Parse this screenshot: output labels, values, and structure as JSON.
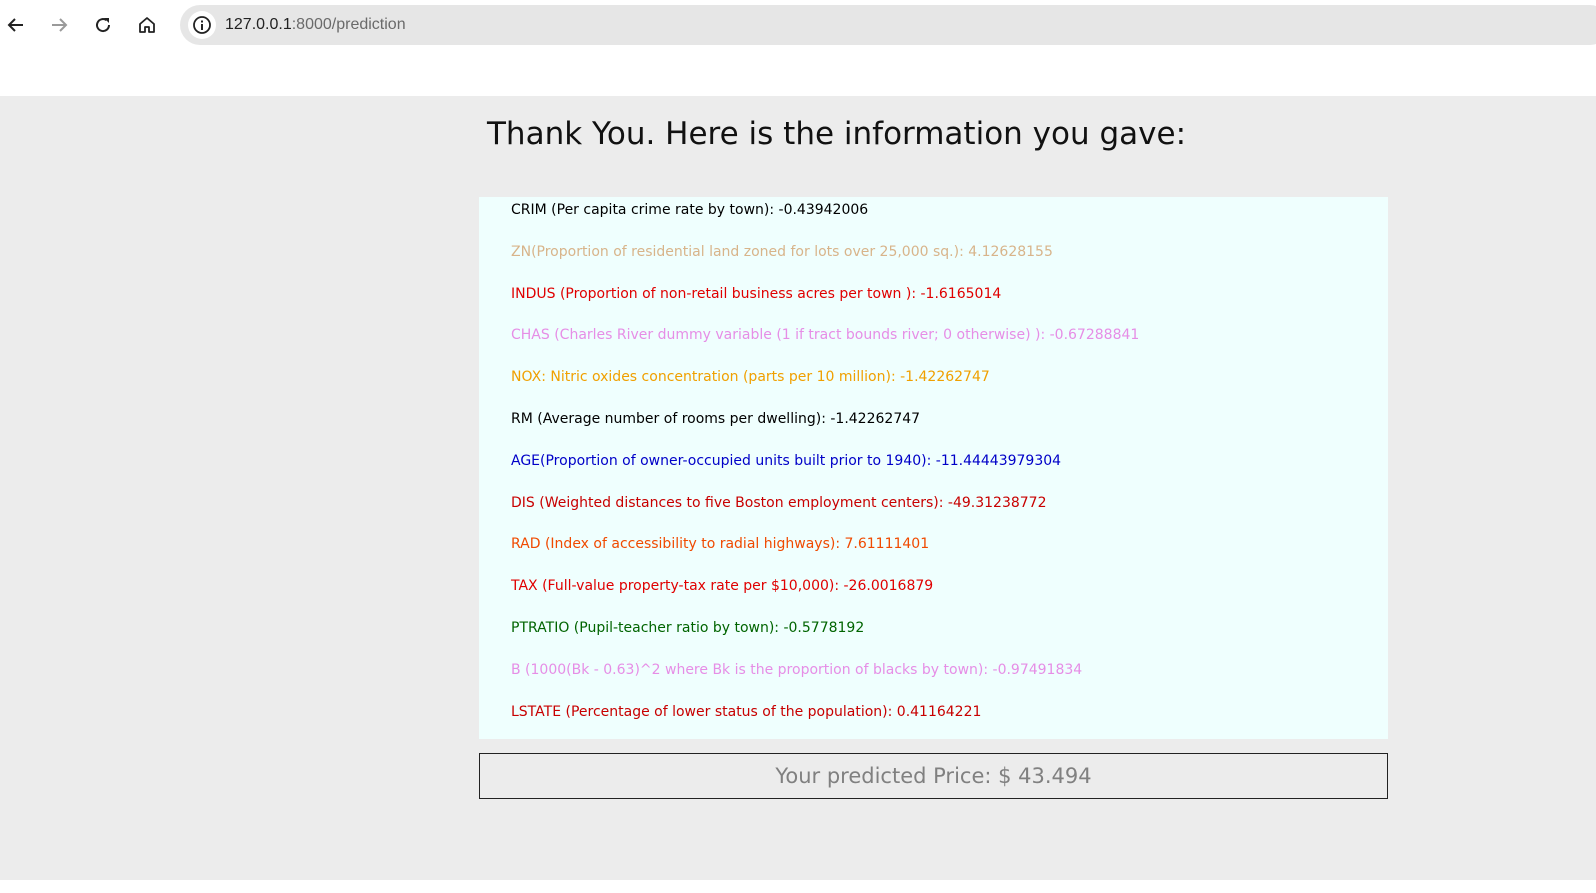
{
  "browser": {
    "url_host": "127.0.0.1",
    "url_path": ":8000/prediction"
  },
  "page": {
    "heading": "Thank You. Here is the information you gave:",
    "rows": [
      {
        "text": "CRIM (Per capita crime rate by town): -0.43942006",
        "color": "#000000"
      },
      {
        "text": "ZN(Proportion of residential land zoned for lots over 25,000 sq.): 4.12628155",
        "color": "#d8b48a"
      },
      {
        "text": "INDUS (Proportion of non-retail business acres per town ): -1.6165014",
        "color": "#e00000"
      },
      {
        "text": "CHAS (Charles River dummy variable (1 if tract bounds river; 0 otherwise) ): -0.67288841",
        "color": "#e68ee6"
      },
      {
        "text": "NOX: Nitric oxides concentration (parts per 10 million): -1.42262747",
        "color": "#f0a000"
      },
      {
        "text": "RM (Average number of rooms per dwelling): -1.42262747",
        "color": "#000000"
      },
      {
        "text": "AGE(Proportion of owner-occupied units built prior to 1940): -11.44443979304",
        "color": "#0000c8"
      },
      {
        "text": "DIS (Weighted distances to five Boston employment centers): -49.31238772",
        "color": "#c80000"
      },
      {
        "text": "RAD (Index of accessibility to radial highways): 7.61111401",
        "color": "#f04a00"
      },
      {
        "text": "TAX (Full-value property-tax rate per $10,000): -26.0016879",
        "color": "#e00000"
      },
      {
        "text": "PTRATIO (Pupil-teacher ratio by town): -0.5778192",
        "color": "#006400"
      },
      {
        "text": "B (1000(Bk - 0.63)^2 where Bk is the proportion of blacks by town): -0.97491834",
        "color": "#e68ee6"
      },
      {
        "text": "LSTATE (Percentage of lower status of the population): 0.41164221",
        "color": "#c80000"
      }
    ],
    "prediction": "Your predicted Price: $ 43.494"
  }
}
